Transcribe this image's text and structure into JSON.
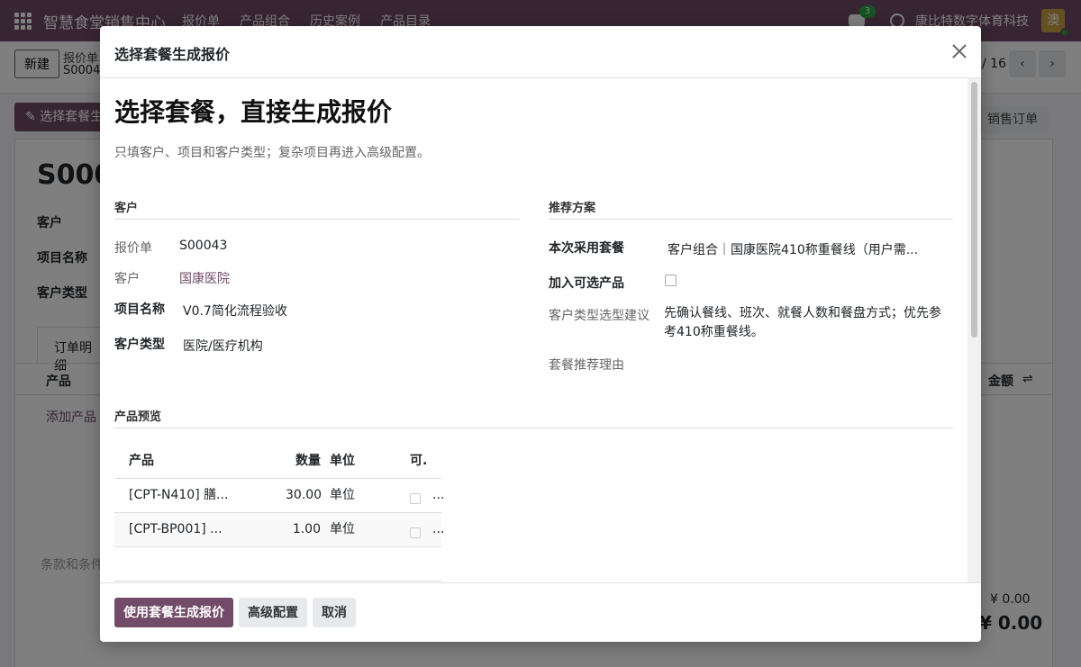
{
  "navbar": {
    "brand": "智慧食堂销售中心",
    "menus": [
      "报价单",
      "产品组合",
      "历史案例",
      "产品目录"
    ],
    "chat_count": "3",
    "company": "康比特数字体育科技",
    "avatar_letter": "澳"
  },
  "control_panel": {
    "new_label": "新建",
    "breadcrumb": "报价单",
    "record_id": "S0004",
    "pager_total": "/ 16"
  },
  "actions": {
    "choose_package_label": "选择套餐生",
    "sales_order_label": "销售订单"
  },
  "sheet": {
    "title": "S000",
    "labels": [
      "客户",
      "项目名称",
      "客户类型"
    ],
    "tab": "订单明细",
    "col_product": "产品",
    "col_amount": "金额",
    "add_product": "添加产品",
    "terms": "条款和条件",
    "total_small": "¥ 0.00",
    "total_big": "¥ 0.00"
  },
  "modal": {
    "title": "选择套餐生成报价",
    "heading": "选择套餐，直接生成报价",
    "subtitle": "只填客户、项目和客户类型；复杂项目再进入高级配置。",
    "customer_section": "客户",
    "quote_label": "报价单",
    "quote_value": "S00043",
    "customer_label": "客户",
    "customer_value": "国康医院",
    "project_label": "项目名称",
    "project_value": "V0.7简化流程验收",
    "ctype_label": "客户类型",
    "ctype_value": "医院/医疗机构",
    "rec_section": "推荐方案",
    "package_label": "本次采用套餐",
    "package_value": "客户组合｜国康医院410称重餐线（用户需...",
    "optional_label": "加入可选产品",
    "optional_checked": false,
    "advice_label": "客户类型选型建议",
    "advice_value": "先确认餐线、班次、就餐人数和餐盘方式；优先参考410称重餐线。",
    "reason_label": "套餐推荐理由",
    "preview_section": "产品预览",
    "preview_table": {
      "headers": [
        "产品",
        "数量",
        "单位",
        "可."
      ],
      "rows": [
        {
          "product": "[CPT-N410] 膳...",
          "qty": "30.00",
          "unit": "单位",
          "more": "..."
        },
        {
          "product": "[CPT-BP001] ...",
          "qty": "1.00",
          "unit": "单位",
          "more": "..."
        }
      ]
    },
    "buttons": {
      "primary": "使用套餐生成报价",
      "advanced": "高级配置",
      "cancel": "取消"
    }
  },
  "colors": {
    "brand": "#714b67",
    "badge": "#28a745"
  }
}
